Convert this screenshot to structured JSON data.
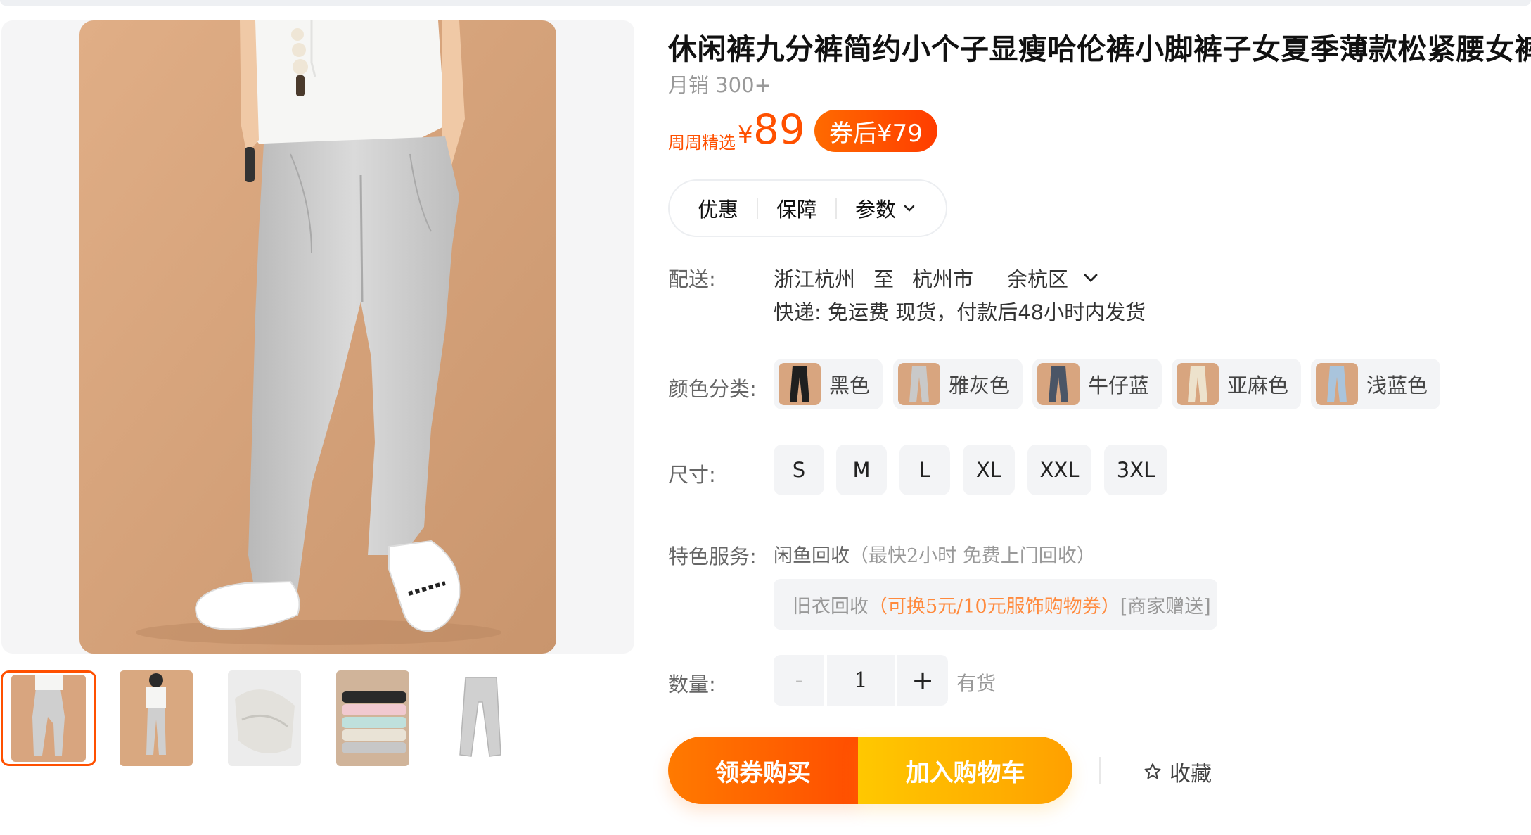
{
  "product": {
    "title": "休闲裤九分裤简约小个子显瘦哈伦裤小脚裤子女夏季薄款松紧腰女裤",
    "sales": "月销 300+",
    "price_tag": "周周精选",
    "currency": "¥",
    "price": "89",
    "coupon_price": "券后¥79",
    "accent_color": "#ff5000"
  },
  "gallery": {
    "main_image_subject": "light grey linen pants",
    "selected_thumbnail": 1,
    "thumbnails": [
      "side view",
      "back view",
      "fabric detail",
      "color stack",
      "flat lay"
    ]
  },
  "tabs": [
    {
      "label": "优惠"
    },
    {
      "label": "保障"
    },
    {
      "label": "参数"
    }
  ],
  "delivery": {
    "label": "配送:",
    "from": "浙江杭州",
    "to_word": "至",
    "city": "杭州市",
    "district": "余杭区",
    "detail": "快递: 免运费  现货，付款后48小时内发货"
  },
  "colors": {
    "label": "颜色分类:",
    "options": [
      {
        "name": "黑色",
        "swatch": "#1f1f1f"
      },
      {
        "name": "雅灰色",
        "swatch": "#c9c9c9"
      },
      {
        "name": "牛仔蓝",
        "swatch": "#4a5566"
      },
      {
        "name": "亚麻色",
        "swatch": "#d8c7a8"
      },
      {
        "name": "浅蓝色",
        "swatch": "#a9c4dc"
      }
    ]
  },
  "sizes": {
    "label": "尺寸:",
    "options": [
      "S",
      "M",
      "L",
      "XL",
      "XXL",
      "3XL"
    ]
  },
  "service": {
    "label": "特色服务:",
    "name": "闲鱼回收",
    "note": "（最快2小时 免费上门回收）",
    "recycle_prefix": "旧衣回收",
    "recycle_offer": "（可换5元/10元服饰购物券）",
    "recycle_suffix": "[商家赠送]"
  },
  "quantity": {
    "label": "数量:",
    "minus": "-",
    "value": "1",
    "plus": "+",
    "stock": "有货"
  },
  "actions": {
    "buy": "领券购买",
    "cart": "加入购物车",
    "favorite": "收藏"
  }
}
